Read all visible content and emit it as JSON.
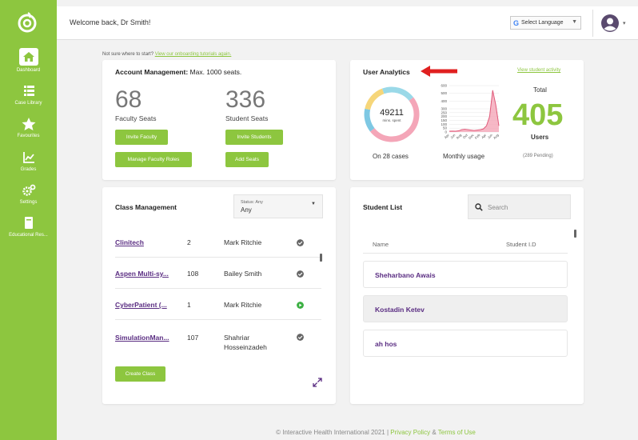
{
  "sidebar": {
    "items": [
      {
        "label": "Dashboard",
        "icon": "home-icon",
        "active": true
      },
      {
        "label": "Case Library",
        "icon": "list-icon"
      },
      {
        "label": "Favourites",
        "icon": "star-icon"
      },
      {
        "label": "Grades",
        "icon": "chart-icon"
      },
      {
        "label": "Settings",
        "icon": "gear-icon"
      },
      {
        "label": "Educational Res...",
        "icon": "book-icon"
      }
    ]
  },
  "header": {
    "welcome": "Welcome back, Dr Smith!",
    "language_label": "Select Language",
    "language_caret": "▼"
  },
  "onboarding": {
    "prefix": "Not sure where to start?",
    "link": "View our onboarding tutorials again."
  },
  "account": {
    "title": "Account Management:",
    "subtitle": "Max. 1000 seats.",
    "faculty_seats": "68",
    "faculty_label": "Faculty Seats",
    "student_seats": "336",
    "student_label": "Student Seats",
    "invite_faculty": "Invite Faculty",
    "invite_students": "Invite Students",
    "manage_faculty": "Manage Faculty Roles",
    "add_seats": "Add Seats"
  },
  "analytics": {
    "title": "User Analytics",
    "view_activity": "View student activity",
    "donut_value": "49211",
    "donut_sub": "mins. spent",
    "cases_label": "On 28 cases",
    "monthly_label": "Monthly usage",
    "total_label": "Total",
    "total_value": "405",
    "users_label": "Users",
    "pending": "(289 Pending)"
  },
  "colors": {
    "brand_green": "#8dc63f",
    "purple": "#5a2d82",
    "pink": "#f4a6b8",
    "red_arrow": "#e02020"
  },
  "chart_data": [
    {
      "type": "pie",
      "labels": [],
      "values": [
        50,
        14,
        16,
        20
      ],
      "colors": [
        "#f4a6b8",
        "#7ec8e3",
        "#f6d67a",
        "#9ad9e8"
      ],
      "title": "49211",
      "subtitle": "mins. spent"
    },
    {
      "type": "area",
      "categories": [
        "Apr",
        "May",
        "Jun",
        "Jul",
        "Aug",
        "Sep",
        "Oct",
        "Nov",
        "Dec",
        "Jan",
        "Feb",
        "Mar",
        "Apr",
        "May",
        "Jun",
        "Jul",
        "Aug"
      ],
      "tick_labels": [
        "Apr",
        "Jun",
        "Aug",
        "Oct",
        "Dec",
        "Feb",
        "Apr",
        "Jun",
        "Aug"
      ],
      "values": [
        10,
        12,
        10,
        15,
        30,
        35,
        30,
        25,
        20,
        25,
        30,
        40,
        80,
        200,
        540,
        350,
        80
      ],
      "title": "",
      "xlabel": "",
      "ylabel": "",
      "yticks": [
        0,
        50,
        100,
        150,
        200,
        250,
        300,
        400,
        500,
        600
      ],
      "ylim": [
        0,
        600
      ]
    }
  ],
  "class_management": {
    "title": "Class Management",
    "status_label": "Status: Any",
    "status_value": "Any",
    "rows": [
      {
        "name": "Clinitech",
        "count": "2",
        "owner": "Mark Ritchie",
        "status": "check"
      },
      {
        "name": "Aspen Multi-sy...",
        "count": "108",
        "owner": "Bailey Smith",
        "status": "check"
      },
      {
        "name": "CyberPatient (...",
        "count": "1",
        "owner": "Mark Ritchie",
        "status": "play"
      },
      {
        "name": "SimulationMan...",
        "count": "107",
        "owner": "Shahriar Hosseinzadeh",
        "status": "check"
      }
    ],
    "create_class": "Create Class"
  },
  "student_list": {
    "title": "Student List",
    "search_placeholder": "Search",
    "col_name": "Name",
    "col_id": "Student I.D",
    "students": [
      "Sheharbano Awais",
      "Kostadin Ketev",
      "ah hos"
    ]
  },
  "footer": {
    "copyright": "© Interactive Health International 2021 |",
    "privacy": "Privacy Policy",
    "amp": "&",
    "terms": "Terms of Use"
  }
}
